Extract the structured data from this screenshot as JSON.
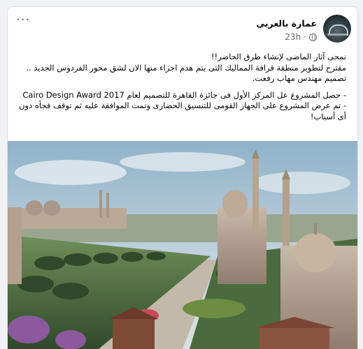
{
  "post": {
    "author": "عمارة بالعربى",
    "time": "23h",
    "separator": "·",
    "more_icon": "···",
    "lines": [
      "نمحى آثار الماضى لإنشاء طرق الحاضر!!",
      "مقترح لتطوير منطقة قرافة المماليك التى يتم هدم اجزاء منها الان لشق محور الفردوس الجديد ..",
      "تصميم مهندس مهاب رفعت.",
      "- حصل المشروع عل المركز الأول فى جائزة القاهرة للتصميم لعام Cairo Design Award 2017",
      "- تم عرض المشروع على الجهاز القومى للتنسيق الحضارى وتمت الموافقة عليه ثم توقف فجأه دون أى أسباب!"
    ]
  },
  "colors": {
    "page_bg": "#f0f2f5",
    "card_bg": "#ffffff",
    "text": "#050505",
    "secondary": "#65676b"
  }
}
